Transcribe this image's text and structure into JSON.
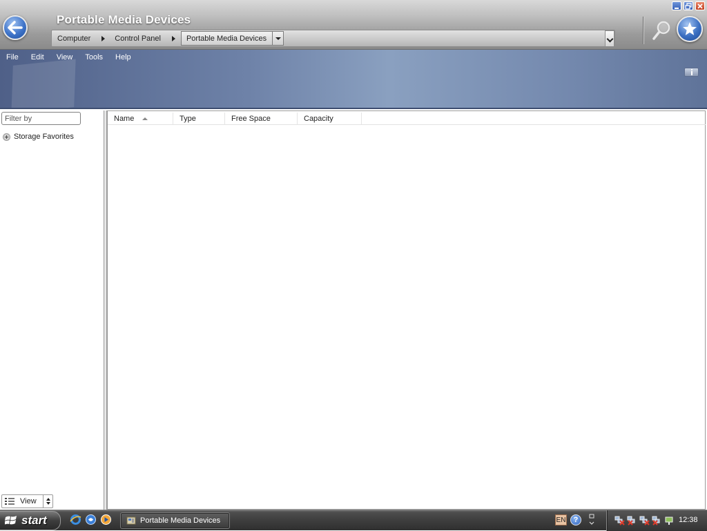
{
  "window": {
    "title": "Portable Media Devices"
  },
  "address": {
    "crumbs": [
      "Computer",
      "Control Panel"
    ],
    "current": "Portable Media Devices"
  },
  "menu": {
    "items": [
      "File",
      "Edit",
      "View",
      "Tools",
      "Help"
    ]
  },
  "sidebar": {
    "filter_placeholder": "Filter by",
    "favorites_label": "Storage Favorites",
    "view_label": "View"
  },
  "table": {
    "columns": [
      "Name",
      "Type",
      "Free Space",
      "Capacity"
    ],
    "sorted_column": "Name",
    "rows": []
  },
  "taskbar": {
    "start_label": "start",
    "task_label": "Portable Media Devices",
    "language": "EN",
    "clock": "12:38"
  },
  "icons": {
    "back": "back-arrow-icon",
    "search": "magnifier-icon",
    "favorites": "star-icon",
    "info": "info-icon"
  },
  "colors": {
    "accent_blue": "#3f74c9",
    "banner": "#7489ae",
    "close_red": "#c23c1c"
  }
}
